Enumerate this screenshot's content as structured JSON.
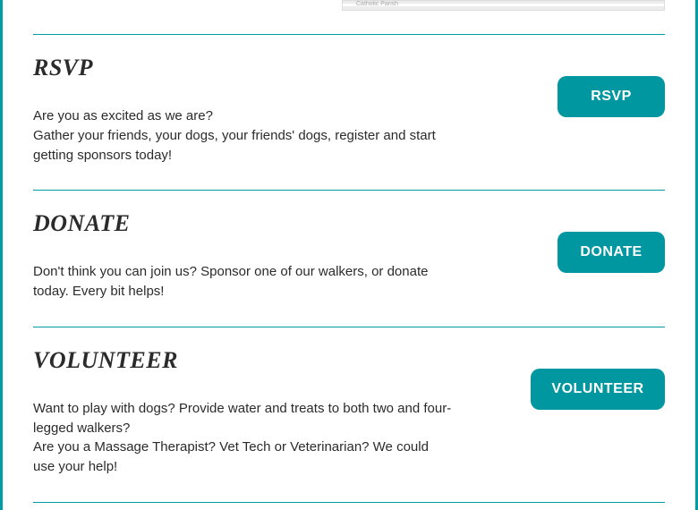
{
  "map": {
    "visible_label": "Catholic Parish"
  },
  "sections": {
    "rsvp": {
      "heading": "RSVP",
      "body_line1": "Are you as excited as we are?",
      "body_line2": "Gather your friends, your dogs, your friends' dogs, register and start getting sponsors today!",
      "button_label": "RSVP"
    },
    "donate": {
      "heading": "DONATE",
      "body": "Don't think you can join us? Sponsor one of our walkers, or donate today. Every bit helps!",
      "button_label": "DONATE"
    },
    "volunteer": {
      "heading": "VOLUNTEER",
      "body_line1": "Want to play with dogs? Provide water and treats to both two and four-legged walkers?",
      "body_line2": "Are you a Massage Therapist? Vet Tech or Veterinarian? We could use your help!",
      "button_label": "VOLUNTEER"
    }
  },
  "colors": {
    "accent": "#009da5",
    "button": "#0097a0",
    "text": "#2b2b2b"
  }
}
